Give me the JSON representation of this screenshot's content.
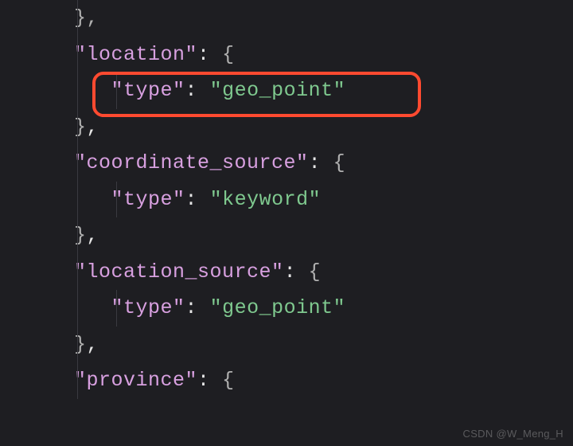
{
  "watermark": "CSDN @W_Meng_H",
  "lines": {
    "l0": {
      "brace": "},",
      "comma": ""
    },
    "l1": {
      "key": "\"location\"",
      "colon": ": ",
      "brace": "{"
    },
    "l2": {
      "key": "\"type\"",
      "colon": ": ",
      "value": "\"geo_point\""
    },
    "l3": {
      "brace": "}",
      "comma": ","
    },
    "l4": {
      "key": "\"coordinate_source\"",
      "colon": ": ",
      "brace": "{"
    },
    "l5": {
      "key": "\"type\"",
      "colon": ": ",
      "value": "\"keyword\""
    },
    "l6": {
      "brace": "}",
      "comma": ","
    },
    "l7": {
      "key": "\"location_source\"",
      "colon": ": ",
      "brace": "{"
    },
    "l8": {
      "key": "\"type\"",
      "colon": ": ",
      "value": "\"geo_point\""
    },
    "l9": {
      "brace": "}",
      "comma": ","
    },
    "l10": {
      "key": "\"province\"",
      "colon": ": ",
      "brace": "{"
    }
  }
}
